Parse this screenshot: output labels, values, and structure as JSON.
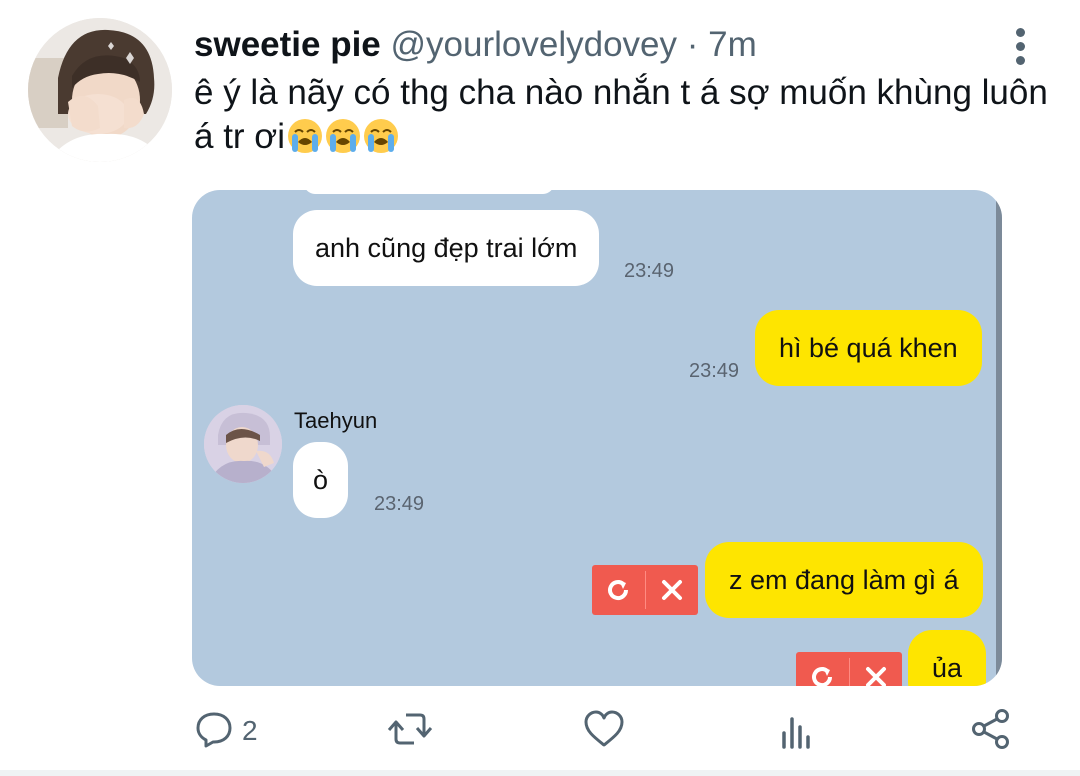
{
  "tweet": {
    "display_name": "sweetie pie",
    "handle": "@yourlovelydovey",
    "separator": "·",
    "time": "7m",
    "text": "ê ý là nãy có thg cha nào nhắn t á sợ muốn khùng luôn á tr ơi",
    "emojis": [
      "loudly-crying-face",
      "loudly-crying-face",
      "loudly-crying-face"
    ]
  },
  "chat": {
    "messages": [
      {
        "side": "in",
        "text": "anh cũng đẹp trai lớm",
        "time": "23:49"
      },
      {
        "side": "out",
        "text": "hì bé quá khen",
        "time": "23:49"
      },
      {
        "side": "in",
        "sender": "Taehyun",
        "text": "ò",
        "time": "23:49"
      },
      {
        "side": "out",
        "text": "z em đang làm gì á",
        "status": "failed"
      },
      {
        "side": "out",
        "text": "ủa",
        "status": "failed"
      }
    ],
    "colors": {
      "background": "#b3c9de",
      "incoming": "#ffffff",
      "outgoing": "#fee500",
      "failed": "#f05a4f"
    }
  },
  "actions": {
    "reply_count": "2",
    "icons": [
      "reply-icon",
      "retweet-icon",
      "like-icon",
      "views-icon",
      "share-icon"
    ]
  }
}
